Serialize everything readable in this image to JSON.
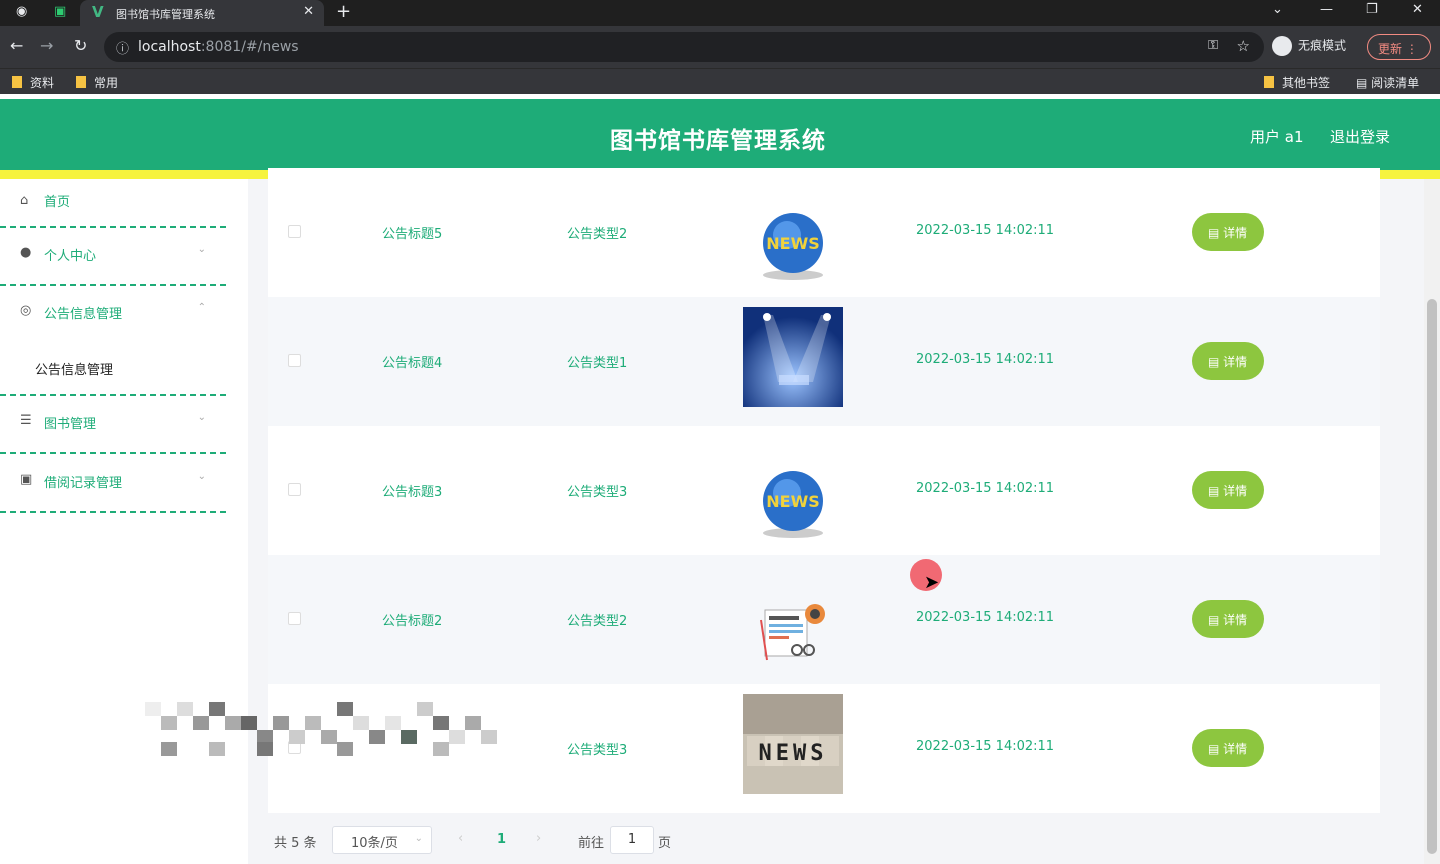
{
  "browser": {
    "tab_title": "图书馆书库管理系统",
    "url_host": "localhost",
    "url_rest": ":8081/#/news",
    "incognito_label": "无痕模式",
    "update_label": "更新",
    "bookmarks": [
      "资料",
      "常用"
    ],
    "bookmarks_right": [
      "其他书签",
      "阅读清单"
    ]
  },
  "header": {
    "title": "图书馆书库管理系统",
    "user": "用户 a1",
    "logout": "退出登录"
  },
  "sidebar": {
    "items": [
      {
        "label": "首页",
        "icon": "home-icon"
      },
      {
        "label": "个人中心",
        "icon": "user-icon"
      },
      {
        "label": "公告信息管理",
        "icon": "dashboard-icon"
      },
      {
        "label": "图书管理",
        "icon": "list-icon"
      },
      {
        "label": "借阅记录管理",
        "icon": "clipboard-icon"
      }
    ],
    "submenu_label": "公告信息管理"
  },
  "table": {
    "rows": [
      {
        "title": "公告标题5",
        "type": "公告类型2",
        "image": "globe-news",
        "time": "2022-03-15 14:02:11",
        "action": "详情"
      },
      {
        "title": "公告标题4",
        "type": "公告类型1",
        "image": "stage-news",
        "time": "2022-03-15 14:02:11",
        "action": "详情"
      },
      {
        "title": "公告标题3",
        "type": "公告类型3",
        "image": "globe-news",
        "time": "2022-03-15 14:02:11",
        "action": "详情"
      },
      {
        "title": "公告标题2",
        "type": "公告类型2",
        "image": "newspaper",
        "time": "2022-03-15 14:02:11",
        "action": "详情"
      },
      {
        "title": "",
        "type": "公告类型3",
        "image": "news-blocks",
        "time": "2022-03-15 14:02:11",
        "action": "详情"
      }
    ]
  },
  "pagination": {
    "total": "共 5 条",
    "page_size": "10条/页",
    "current_page": "1",
    "goto_label": "前往",
    "goto_value": "1",
    "page_unit": "页"
  },
  "colors": {
    "brand": "#1eac78",
    "accent_bar": "#f6f33e",
    "button": "#8dc63f"
  }
}
